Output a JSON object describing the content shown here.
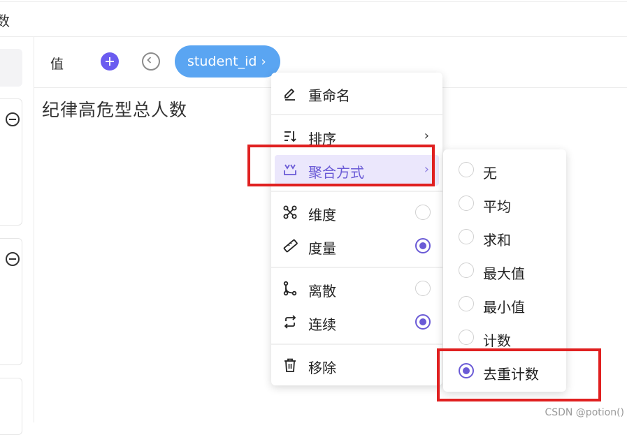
{
  "top": {
    "title": "数"
  },
  "fieldbar": {
    "value_label": "值",
    "chip_label": "student_id",
    "chip_chevron": "›"
  },
  "chart": {
    "title": "纪律高危型总人数"
  },
  "menu": {
    "items": [
      {
        "label": "重命名",
        "icon": "pencil-icon"
      },
      {
        "label": "排序",
        "icon": "sort-icon",
        "chevron": "›"
      },
      {
        "label": "聚合方式",
        "icon": "aggregate-icon",
        "chevron": "›",
        "active": true
      },
      {
        "label": "维度",
        "icon": "dimension-icon",
        "checked": false
      },
      {
        "label": "度量",
        "icon": "ruler-icon",
        "checked": true
      },
      {
        "label": "离散",
        "icon": "discrete-icon",
        "checked": false
      },
      {
        "label": "连续",
        "icon": "loop-icon",
        "checked": true
      },
      {
        "label": "移除",
        "icon": "trash-icon"
      }
    ]
  },
  "submenu": {
    "items": [
      {
        "label": "无",
        "checked": false
      },
      {
        "label": "平均",
        "checked": false
      },
      {
        "label": "求和",
        "checked": false
      },
      {
        "label": "最大值",
        "checked": false
      },
      {
        "label": "最小值",
        "checked": false
      },
      {
        "label": "计数",
        "checked": false
      },
      {
        "label": "去重计数",
        "checked": true
      }
    ]
  },
  "watermark": "CSDN @potion()",
  "colors": {
    "accent": "#6a5ad6",
    "chip": "#5aa5f2",
    "highlight": "#e02020",
    "active_bg": "#ebe7fc"
  }
}
